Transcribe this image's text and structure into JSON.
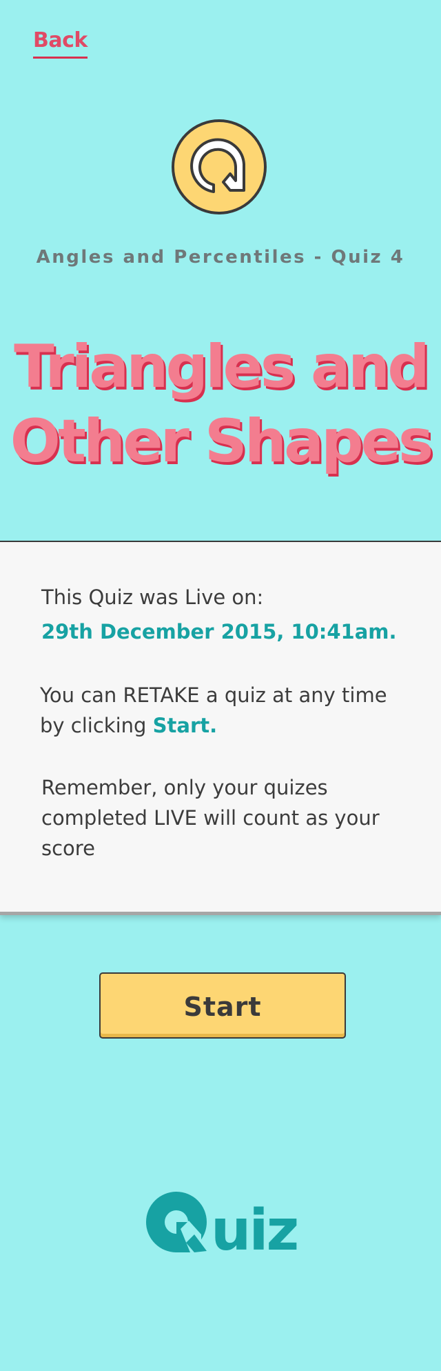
{
  "nav": {
    "back_label": "Back"
  },
  "header": {
    "logo_icon": "quiz-q-icon",
    "subtitle": "Angles and Percentiles - Quiz 4",
    "title_line1": "Triangles and",
    "title_line2": "Other Shapes"
  },
  "info": {
    "live_label": "This Quiz was Live on:",
    "live_date": "29th December 2015, 10:41am.",
    "retake_text_line1": "You can RETAKE a quiz at any time",
    "retake_text_line2_prefix": "by clicking ",
    "retake_start_ref": "Start.",
    "remember_text_line1": "Remember, only your quizes",
    "remember_text_line2": "completed LIVE will count as your",
    "remember_text_line3": "score"
  },
  "actions": {
    "start_label": "Start"
  },
  "footer": {
    "brand_text": "uiz"
  },
  "colors": {
    "background": "#9bf0ef",
    "accent_pink": "#f37d8f",
    "accent_red": "#e04a66",
    "accent_teal": "#17a2a3",
    "button_yellow": "#fdd673",
    "panel_bg": "#f7f7f7"
  }
}
